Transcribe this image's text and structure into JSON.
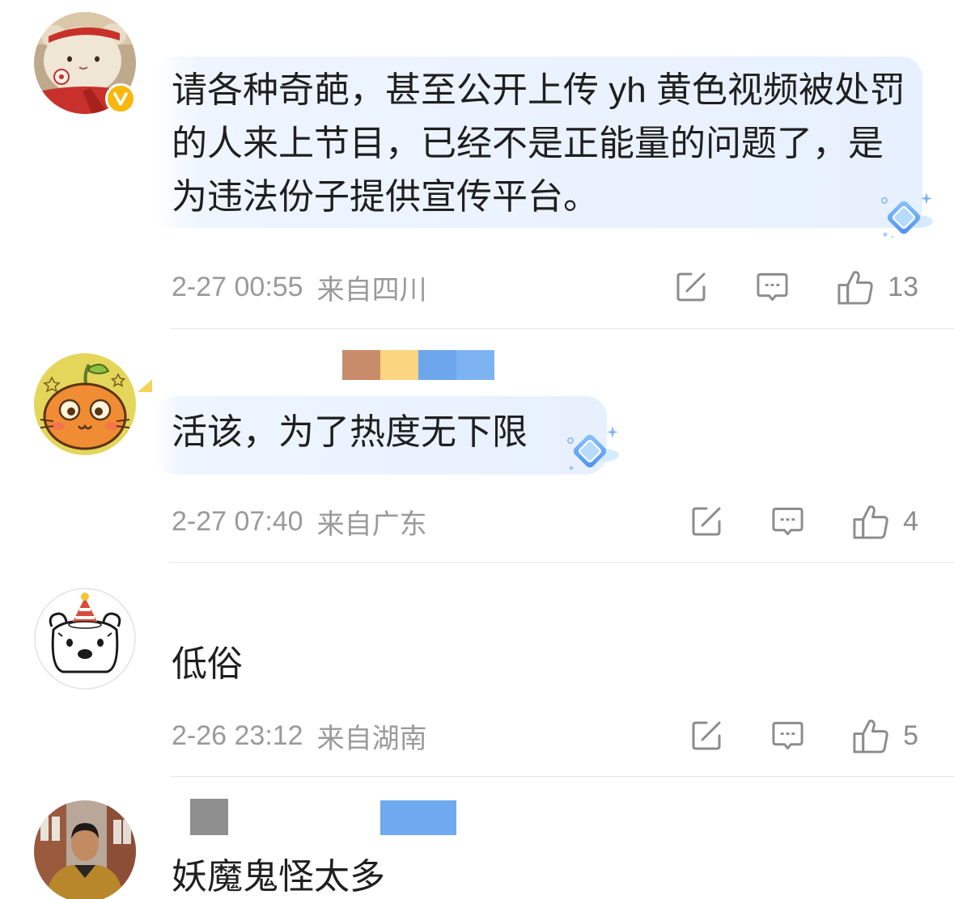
{
  "colors": {
    "text": "#1f1f1f",
    "meta": "#9a9a9a",
    "icon": "#8c8c8c",
    "divider": "#e6e6e6",
    "bubble": "#e7f0fe",
    "badge": "#f6b80f"
  },
  "action_icons": [
    "share-icon",
    "comment-icon",
    "like-icon"
  ],
  "comments": [
    {
      "avatar_icon": "plush-toy-avatar",
      "badge_icon": "verified-badge-icon",
      "decoration_icon": "diamond-bubble-icon",
      "text_lines": [
        "请各种奇葩，甚至公开上传 yh 黄色视频被处罚",
        "的人来上节目，已经不是正能量的问题了，是",
        "为违法份子提供宣传平台。"
      ],
      "time": "2-27 00:55",
      "location": "来自四川",
      "likes": "13"
    },
    {
      "avatar_icon": "orange-cat-avatar",
      "decoration_icon": "diamond-bubble-icon",
      "redaction_colors": [
        "#c98c6b",
        "#fbd57f",
        "#6ea6ee",
        "#7db3f1"
      ],
      "text_lines": [
        "活该，为了热度无下限"
      ],
      "time": "2-27 07:40",
      "location": "来自广东",
      "likes": "4"
    },
    {
      "avatar_icon": "party-hat-bear-avatar",
      "text_lines": [
        "低俗"
      ],
      "time": "2-26 23:12",
      "location": "来自湖南",
      "likes": "5"
    },
    {
      "avatar_icon": "man-photo-avatar",
      "redaction_colors": [
        "#8f8f8f",
        "#6fa9ef"
      ],
      "text_lines": [
        "妖魔鬼怪太多"
      ]
    }
  ]
}
